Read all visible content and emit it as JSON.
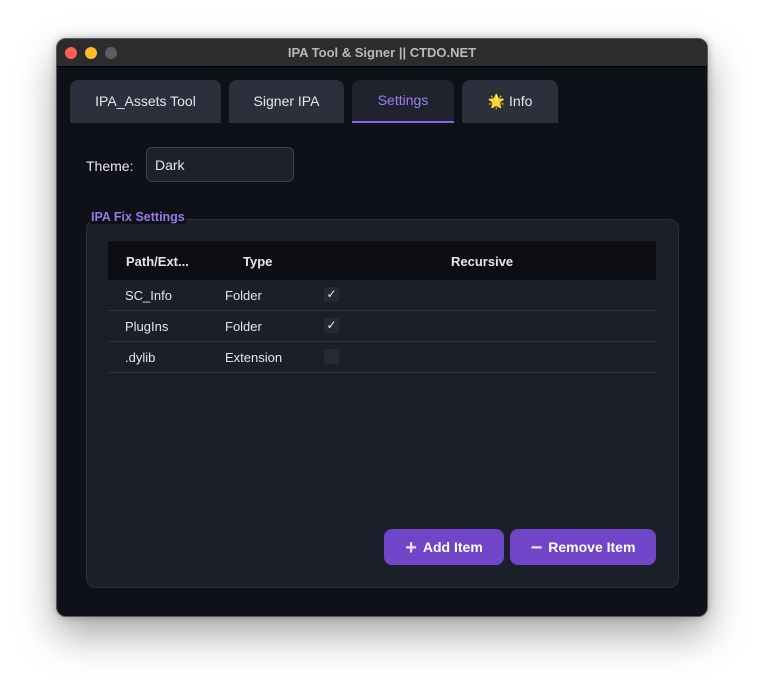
{
  "window": {
    "title": "IPA Tool & Signer || CTDO.NET"
  },
  "tabs": [
    {
      "label": "IPA_Assets Tool",
      "icon": ""
    },
    {
      "label": "Signer IPA",
      "icon": ""
    },
    {
      "label": "Settings",
      "icon": "",
      "active": true
    },
    {
      "label": "Info",
      "icon": "🌟"
    }
  ],
  "theme": {
    "label": "Theme:",
    "value": "Dark"
  },
  "fix_settings": {
    "title": "IPA Fix Settings",
    "columns": [
      "Path/Ext...",
      "Type",
      "Recursive"
    ],
    "rows": [
      {
        "path": "SC_Info",
        "type": "Folder",
        "recursive": true
      },
      {
        "path": "PlugIns",
        "type": "Folder",
        "recursive": true
      },
      {
        "path": ".dylib",
        "type": "Extension",
        "recursive": false
      }
    ],
    "add_label": "Add Item",
    "add_icon": "+",
    "remove_label": "Remove Item",
    "remove_icon": "−"
  },
  "colors": {
    "accent": "#7045c8",
    "active_tab_text": "#9f7ef7",
    "window_bg": "#0e1118"
  }
}
